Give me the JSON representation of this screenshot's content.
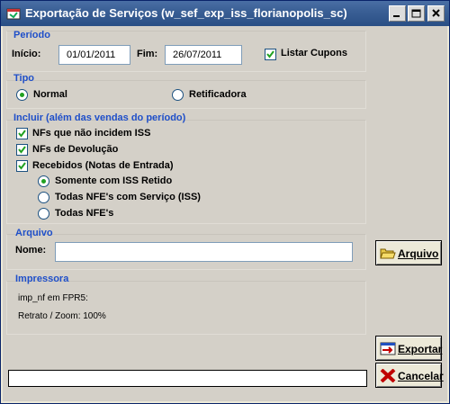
{
  "window": {
    "title": "Exportação de Serviços (w_sef_exp_iss_florianopolis_sc)"
  },
  "periodo": {
    "title": "Período",
    "inicio_label": "Início:",
    "inicio_value": "01/01/2011",
    "fim_label": "Fim:",
    "fim_value": "26/07/2011",
    "listar_cupons_label": "Listar Cupons",
    "listar_cupons_checked": true
  },
  "tipo": {
    "title": "Tipo",
    "options": [
      "Normal",
      "Retificadora"
    ],
    "selected": "Normal"
  },
  "incluir": {
    "title": "Incluir (além das vendas do período)",
    "checks": [
      "NFs que não incidem ISS",
      "NFs de Devolução",
      "Recebidos (Notas de Entrada)"
    ],
    "radios": [
      "Somente com ISS Retido",
      "Todas NFE's com Serviço (ISS)",
      "Todas NFE's"
    ],
    "selected_radio": "Somente com ISS Retido"
  },
  "arquivo": {
    "title": "Arquivo",
    "nome_label": "Nome:",
    "nome_value": "",
    "button_label": "Arquivo"
  },
  "impressora": {
    "title": "Impressora",
    "line1": "imp_nf em FPR5:",
    "line2": "Retrato / Zoom: 100%"
  },
  "buttons": {
    "exportar": "Exportar",
    "cancelar": "Cancelar"
  },
  "colors": {
    "group_title": "#1f4fc9",
    "titlebar": "#3a5f95",
    "background": "#d4d0c8"
  },
  "icons": [
    "app-icon",
    "minimize-icon",
    "maximize-icon",
    "close-icon",
    "folder-open-icon",
    "export-icon",
    "cancel-x-icon"
  ]
}
